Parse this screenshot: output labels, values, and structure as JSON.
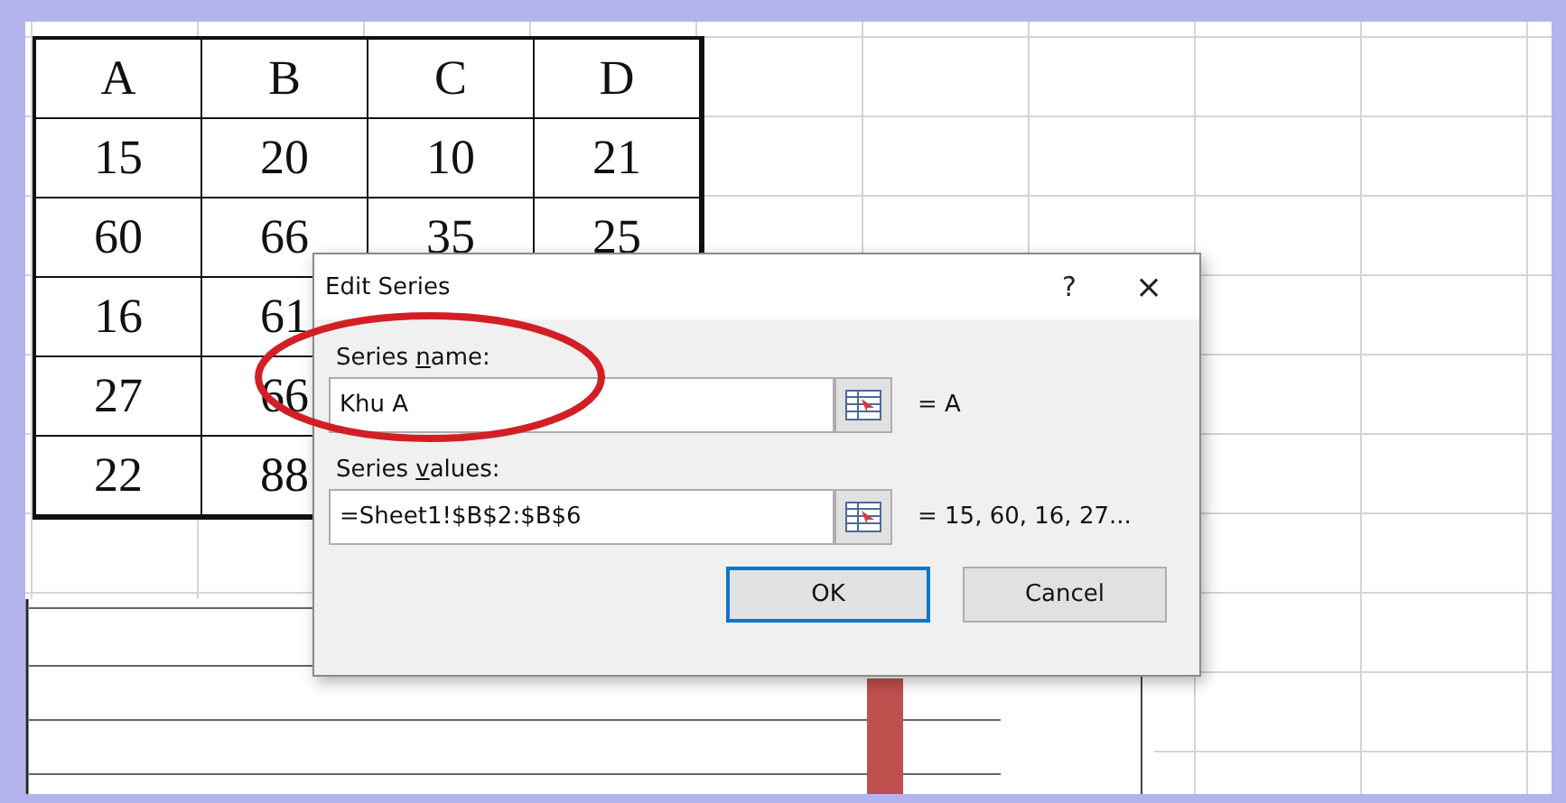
{
  "sheet": {
    "columns": [
      "A",
      "B",
      "C",
      "D"
    ],
    "rows": [
      [
        "15",
        "20",
        "10",
        "21"
      ],
      [
        "60",
        "66",
        "35",
        "25"
      ],
      [
        "16",
        "61"
      ],
      [
        "27",
        "66"
      ],
      [
        "22",
        "88"
      ]
    ]
  },
  "dialog": {
    "title": "Edit Series",
    "help": "?",
    "close": "×",
    "fields": [
      {
        "label_before": "Series ",
        "access_key": "n",
        "label_after": "ame:",
        "value": "Khu A",
        "preview": "= A"
      },
      {
        "label_before": "Series ",
        "access_key": "v",
        "label_after": "alues:",
        "value": "=Sheet1!$B$2:$B$6",
        "preview": "= 15, 60, 16, 27..."
      }
    ],
    "buttons": [
      {
        "label": "OK",
        "default": true
      },
      {
        "label": "Cancel",
        "default": false
      }
    ]
  }
}
